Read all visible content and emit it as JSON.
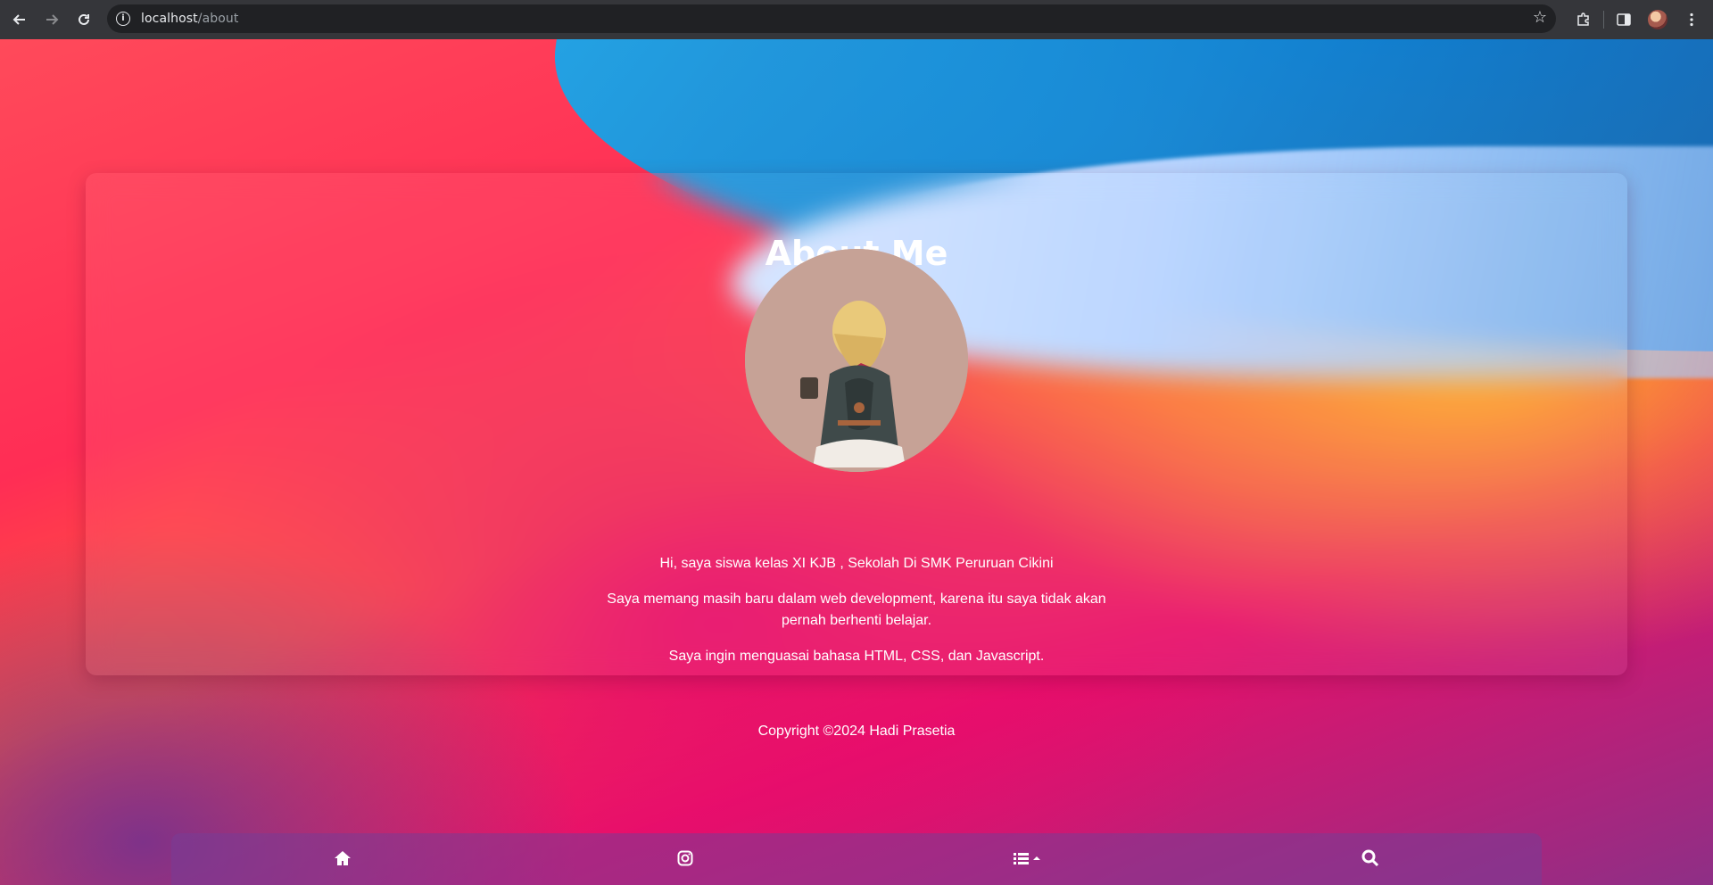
{
  "browser": {
    "url_host": "localhost",
    "url_path": "/about",
    "icons": {
      "back": "arrow-left-icon",
      "forward": "arrow-right-icon",
      "reload": "reload-icon",
      "site_info": "info-icon",
      "bookmark": "star-icon",
      "extensions": "puzzle-icon",
      "side_panel": "side-panel-icon",
      "profile": "avatar",
      "menu": "more-vert-icon"
    }
  },
  "page": {
    "title": "About Me",
    "bio": [
      "Hi, saya siswa kelas XI KJB , Sekolah Di SMK Peruruan Cikini",
      "Saya memang masih baru dalam web development, karena itu saya tidak akan pernah berhenti belajar.",
      "Saya ingin menguasai bahasa HTML, CSS, dan Javascript."
    ],
    "copyright": "Copyright ©2024 Hadi Prasetia"
  },
  "bottom_nav": {
    "items": [
      {
        "name": "home",
        "icon": "home-icon"
      },
      {
        "name": "instagram",
        "icon": "instagram-icon"
      },
      {
        "name": "menu",
        "icon": "list-caret-up-icon"
      },
      {
        "name": "search",
        "icon": "search-icon"
      }
    ]
  },
  "colors": {
    "chrome_bg": "#35363a",
    "omnibox_bg": "#202124",
    "text_white": "#ffffff",
    "bottom_nav_bg": "#7a3c96"
  }
}
